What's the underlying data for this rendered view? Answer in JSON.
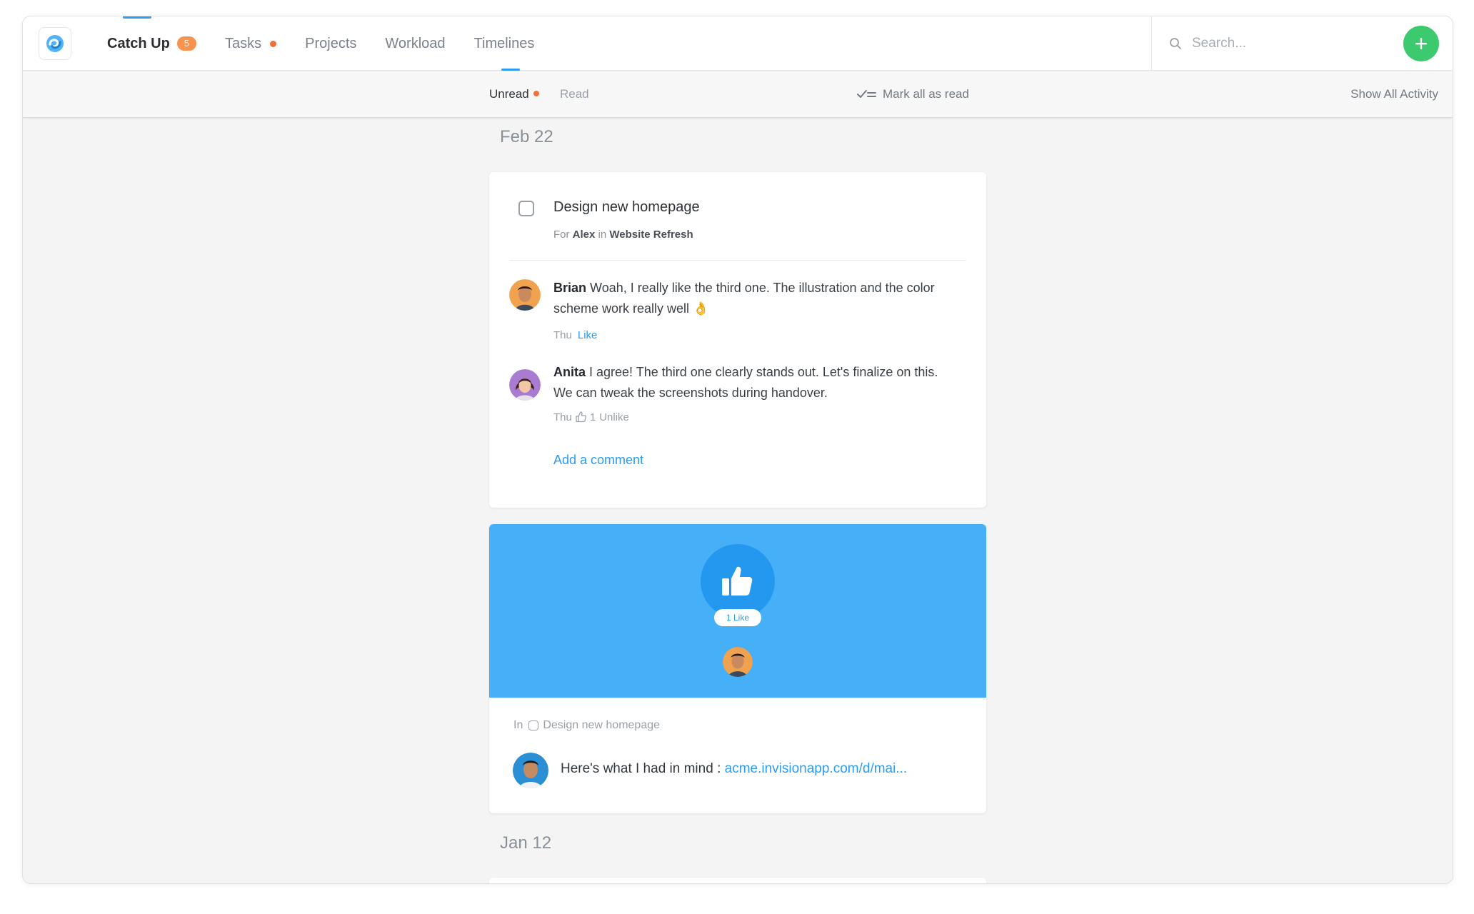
{
  "nav": {
    "items": [
      {
        "label": "Catch Up",
        "badge": "5"
      },
      {
        "label": "Tasks"
      },
      {
        "label": "Projects"
      },
      {
        "label": "Workload"
      },
      {
        "label": "Timelines"
      }
    ]
  },
  "search": {
    "placeholder": "Search..."
  },
  "subbar": {
    "unread": "Unread",
    "read": "Read",
    "mark_all": "Mark all as read",
    "show_all": "Show All Activity"
  },
  "feed": {
    "date1": "Feb 22",
    "task": {
      "title": "Design new homepage",
      "for_prefix": "For",
      "assignee": "Alex",
      "in_word": "in",
      "project": "Website Refresh"
    },
    "comments": [
      {
        "author": "Brian",
        "text": "Woah, I really like the third one. The illustration and the color scheme work really well 👌",
        "day": "Thu",
        "action": "Like"
      },
      {
        "author": "Anita",
        "text": "I agree! The third one clearly stands out. Let's finalize on this. We can tweak the screenshots during handover.",
        "day": "Thu",
        "likes": "1",
        "action": "Unlike"
      }
    ],
    "add_comment": "Add a comment",
    "like_card": {
      "pill": "1 Like",
      "in_label": "In",
      "in_task": "Design new homepage",
      "message": "Here's what I had in mind : ",
      "link": "acme.invisionapp.com/d/mai..."
    },
    "date2": "Jan 12"
  },
  "colors": {
    "accent": "#2d9bf0",
    "badge": "#f7934c",
    "add_button": "#3dca6e",
    "like_banner": "#45aff7"
  }
}
